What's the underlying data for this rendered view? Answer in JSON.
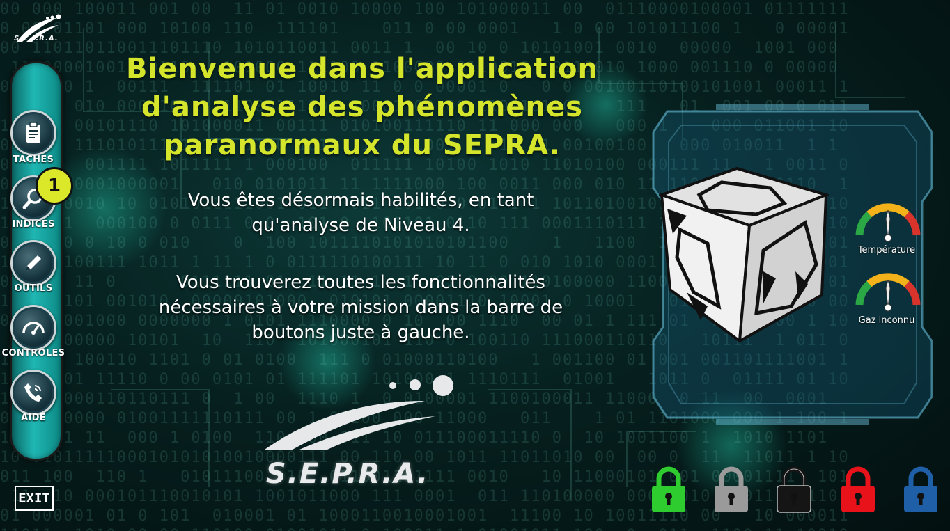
{
  "brand": {
    "name": "S.E.P.R.A.",
    "logo_icon": "sepra-logo-icon"
  },
  "sidebar": {
    "items": [
      {
        "label": "TACHES",
        "icon": "clipboard-icon"
      },
      {
        "label": "INDICES",
        "icon": "magnifier-icon"
      },
      {
        "label": "OUTILS",
        "icon": "pencil-icon"
      },
      {
        "label": "CONTROLES",
        "icon": "speedometer-icon"
      },
      {
        "label": "AIDE",
        "icon": "phone-icon"
      }
    ],
    "badge": "1"
  },
  "exit_label": "EXIT",
  "welcome": {
    "title_lines": [
      "Bienvenue dans l'application",
      "d'analyse des phénomènes",
      "paranormaux du SEPRA."
    ],
    "paragraph1_lines": [
      "Vous êtes désormais habilités, en tant",
      "qu'analyse de Niveau 4."
    ],
    "paragraph2_lines": [
      "Vous trouverez toutes les fonctionnalités",
      "nécessaires à votre mission dans la barre de",
      "boutons juste à gauche."
    ]
  },
  "gauges": [
    {
      "label": "Température",
      "icon": "gauge-icon"
    },
    {
      "label": "Gaz inconnu",
      "icon": "gauge-icon"
    }
  ],
  "locks": [
    {
      "name": "lock-green",
      "color": "#2ecc2e"
    },
    {
      "name": "lock-gray",
      "color": "#9a9a9a"
    },
    {
      "name": "lock-black",
      "color": "#151515"
    },
    {
      "name": "lock-red",
      "color": "#e8121b"
    },
    {
      "name": "lock-blue",
      "color": "#1f5fa8"
    }
  ],
  "colors": {
    "title": "#d4e52c",
    "sidebar_accent": "#1fb7b3",
    "badge": "#dbe82a"
  }
}
